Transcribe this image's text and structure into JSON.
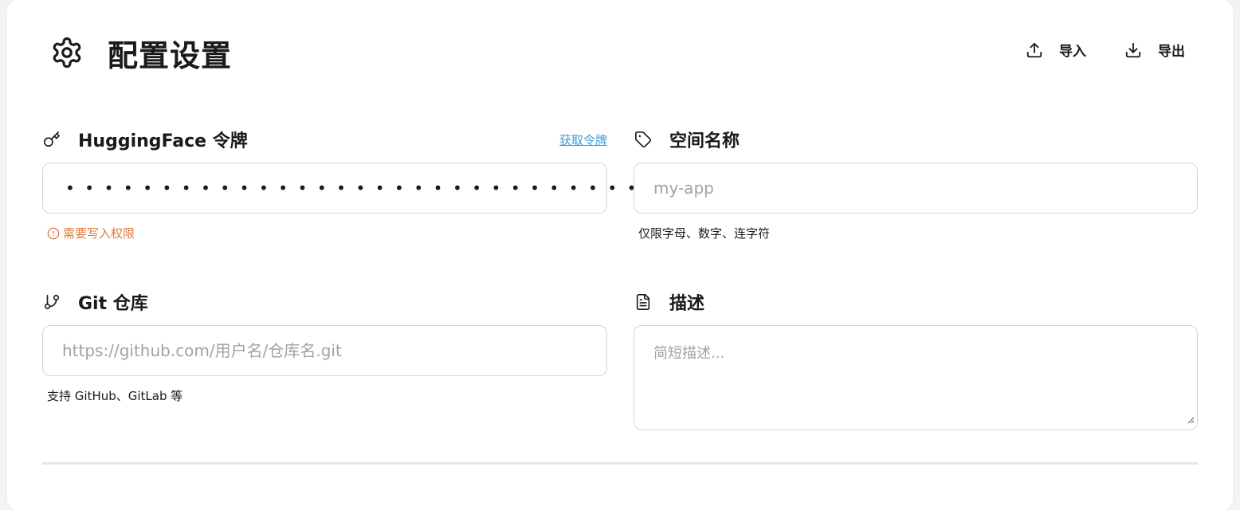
{
  "header": {
    "title": "配置设置",
    "import_label": "导入",
    "export_label": "导出"
  },
  "token_field": {
    "label": "HuggingFace 令牌",
    "link": "获取令牌",
    "masked_value": "••••••••••••••••••••••••••••••••",
    "hint": "需要写入权限",
    "hint_color": "#e07a3c"
  },
  "space_field": {
    "label": "空间名称",
    "placeholder": "my-app",
    "hint": "仅限字母、数字、连字符"
  },
  "git_field": {
    "label": "Git 仓库",
    "placeholder": "https://github.com/用户名/仓库名.git",
    "hint": "支持 GitHub、GitLab 等"
  },
  "desc_field": {
    "label": "描述",
    "placeholder": "简短描述..."
  },
  "colors": {
    "link": "#3b9ed8",
    "warning": "#e07a3c",
    "border": "#d4d4d8"
  }
}
